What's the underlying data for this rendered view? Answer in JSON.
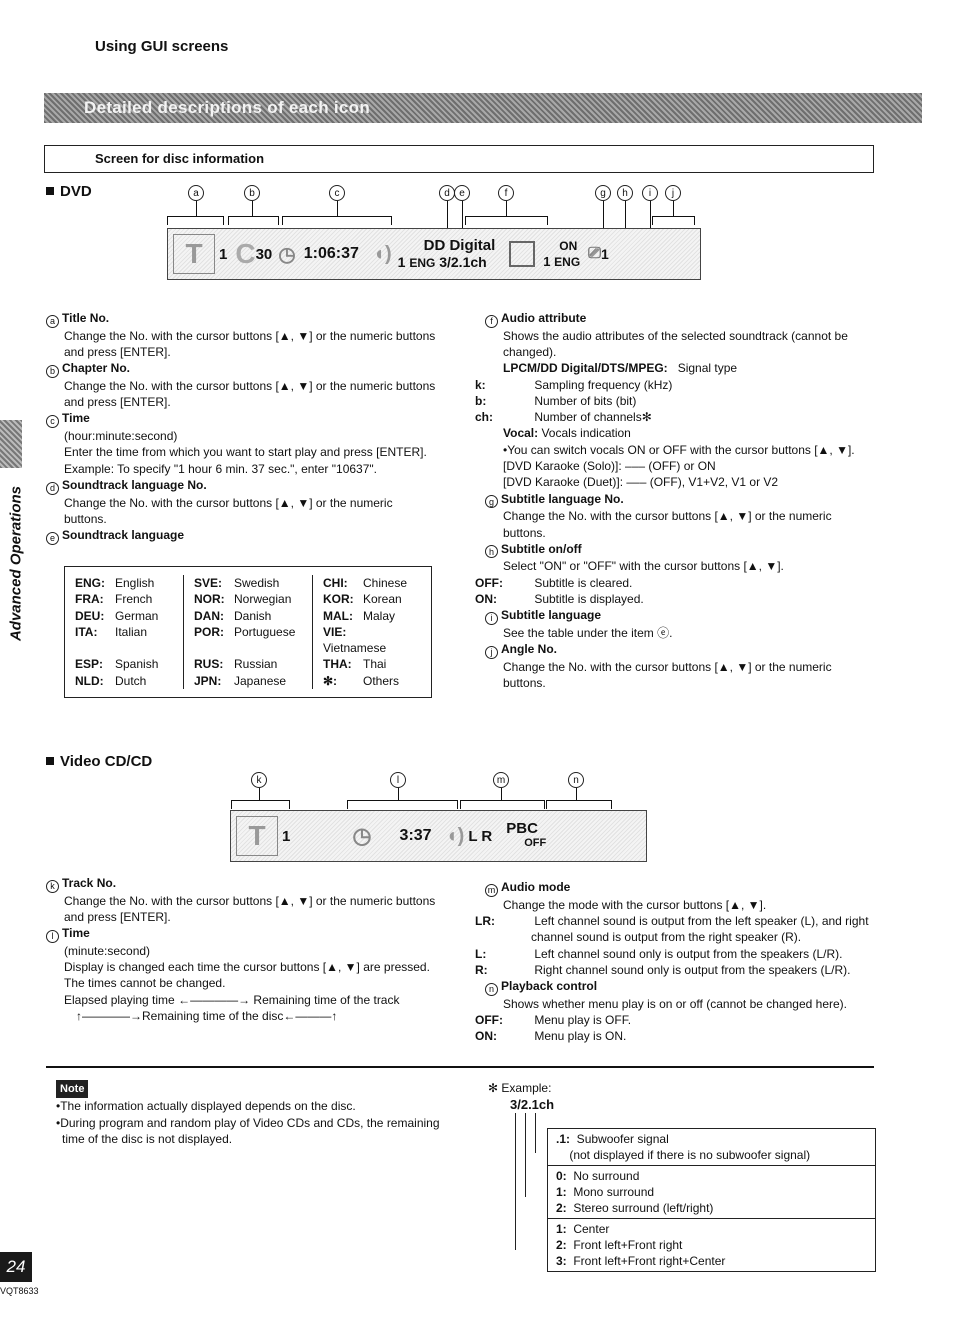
{
  "header": {
    "section_title": "Using GUI screens",
    "banner": "Detailed descriptions of each icon",
    "screen_box_label": "Screen for disc information"
  },
  "side": {
    "tab_label": "Advanced Operations"
  },
  "dvd": {
    "heading": "DVD",
    "callouts": [
      "a",
      "b",
      "c",
      "d",
      "e",
      "f",
      "g",
      "h",
      "i",
      "j"
    ],
    "bar": {
      "title_no": "1",
      "chapter_no": "30",
      "time": "1:06:37",
      "audio_lang_no": "1",
      "audio_lang": "ENG",
      "audio_attr_line1": "DD Digital",
      "audio_attr_line2": "3/2.1ch",
      "subtitle_state": "ON",
      "subtitle_no": "1",
      "subtitle_lang": "ENG",
      "angle_no": "1"
    },
    "left_items": [
      {
        "mark": "a",
        "title": "Title No.",
        "body": [
          "Change the No. with the cursor buttons [▲, ▼] or the numeric buttons and press [ENTER]."
        ]
      },
      {
        "mark": "b",
        "title": "Chapter No.",
        "body": [
          "Change the No. with the cursor buttons [▲, ▼] or the numeric buttons and press [ENTER]."
        ]
      },
      {
        "mark": "c",
        "title": "Time",
        "body": [
          "(hour:minute:second)",
          "Enter the time from which you want to start play and press [ENTER].",
          "Example: To specify \"1 hour 6 min. 37 sec.\", enter \"10637\"."
        ]
      },
      {
        "mark": "d",
        "title": "Soundtrack language No.",
        "body": [
          "Change the No. with the cursor buttons [▲, ▼] or the numeric buttons."
        ]
      },
      {
        "mark": "e",
        "title": "Soundtrack language",
        "body": []
      }
    ],
    "languages": [
      [
        {
          "k": "ENG:",
          "v": "English"
        },
        {
          "k": "FRA:",
          "v": "French"
        },
        {
          "k": "DEU:",
          "v": "German"
        },
        {
          "k": "ITA:",
          "v": "Italian"
        },
        {
          "k": "ESP:",
          "v": "Spanish"
        },
        {
          "k": "NLD:",
          "v": "Dutch"
        }
      ],
      [
        {
          "k": "SVE:",
          "v": "Swedish"
        },
        {
          "k": "NOR:",
          "v": "Norwegian"
        },
        {
          "k": "DAN:",
          "v": "Danish"
        },
        {
          "k": "POR:",
          "v": "Portuguese"
        },
        {
          "k": "RUS:",
          "v": "Russian"
        },
        {
          "k": "JPN:",
          "v": "Japanese"
        }
      ],
      [
        {
          "k": "CHI:",
          "v": "Chinese"
        },
        {
          "k": "KOR:",
          "v": "Korean"
        },
        {
          "k": "MAL:",
          "v": "Malay"
        },
        {
          "k": "VIE:",
          "v": "Vietnamese"
        },
        {
          "k": "THA:",
          "v": "Thai"
        },
        {
          "k": "✻:",
          "v": "Others"
        }
      ]
    ],
    "right_items": {
      "f": {
        "title": "Audio attribute",
        "intro": "Shows the audio attributes of the selected soundtrack (cannot be changed).",
        "signal_label": "LPCM/DD Digital/DTS/MPEG:",
        "signal_value": "Signal type",
        "defs": [
          {
            "k": "k:",
            "v": "Sampling frequency (kHz)"
          },
          {
            "k": "b:",
            "v": "Number of bits (bit)"
          },
          {
            "k": "ch:",
            "v": "Number of channels✻"
          }
        ],
        "vocal_label": "Vocal:",
        "vocal_value": "Vocals indication",
        "vocal_bullet": "•You can switch vocals ON or OFF with the cursor buttons [▲, ▼].",
        "karaoke_solo": "[DVD Karaoke (Solo)]: ––– (OFF) or ON",
        "karaoke_duet": "[DVD Karaoke (Duet)]: ––– (OFF), V1+V2, V1 or V2"
      },
      "g": {
        "title": "Subtitle language No.",
        "body": "Change the No. with the cursor buttons [▲, ▼] or the numeric buttons."
      },
      "h": {
        "title": "Subtitle on/off",
        "body": "Select \"ON\" or \"OFF\" with the cursor buttons [▲, ▼].",
        "defs": [
          {
            "k": "OFF:",
            "v": "Subtitle is cleared."
          },
          {
            "k": "ON:",
            "v": "Subtitle is displayed."
          }
        ]
      },
      "i": {
        "title": "Subtitle language",
        "body": "See the table under the item ⓔ."
      },
      "j": {
        "title": "Angle No.",
        "body": "Change the No. with the cursor buttons [▲, ▼] or the numeric buttons."
      }
    }
  },
  "vcd": {
    "heading": "Video CD/CD",
    "callouts": [
      "k",
      "l",
      "m",
      "n"
    ],
    "bar": {
      "track_no": "1",
      "time": "3:37",
      "audio_mode": "L R",
      "pbc_label": "PBC",
      "pbc_state": "OFF"
    },
    "k": {
      "title": "Track No.",
      "body": "Change the No. with the cursor buttons [▲, ▼] or the numeric buttons and press [ENTER]."
    },
    "l": {
      "title": "Time",
      "sub": "(minute:second)",
      "body": "Display is changed each time the cursor buttons [▲, ▼] are pressed. The times cannot be changed.",
      "flow_line1_a": "Elapsed playing time",
      "flow_line1_b": "Remaining time of the track",
      "flow_line2": "Remaining time of the disc"
    },
    "m": {
      "title": "Audio mode",
      "body": "Change the mode with the cursor buttons [▲, ▼].",
      "defs": [
        {
          "k": "LR:",
          "v": "Left channel sound is output from the left speaker (L), and right channel sound is output from the right speaker (R)."
        },
        {
          "k": "L:",
          "v": "Left channel sound only is output from the speakers (L/R)."
        },
        {
          "k": "R:",
          "v": "Right channel sound only is output from the speakers (L/R)."
        }
      ]
    },
    "n": {
      "title": "Playback control",
      "body": "Shows whether menu play is on or off (cannot be changed here).",
      "defs": [
        {
          "k": "OFF:",
          "v": "Menu play is OFF."
        },
        {
          "k": "ON:",
          "v": "Menu play is ON."
        }
      ]
    }
  },
  "note": {
    "label": "Note",
    "bullets": [
      "•The information actually displayed depends on the disc.",
      "•During program and random play of Video CDs and CDs, the remaining time of the disc is not displayed."
    ]
  },
  "example": {
    "label": "✻ Example:",
    "value": "3/2.1ch",
    "rows": [
      [
        "<b>.1:</b>  Subwoofer signal",
        "    (not displayed if there is no subwoofer signal)"
      ],
      [
        "<b>0:</b>  No surround",
        "<b>1:</b>  Mono surround",
        "<b>2:</b>  Stereo surround (left/right)"
      ],
      [
        "<b>1:</b>  Center",
        "<b>2:</b>  Front left+Front right",
        "<b>3:</b>  Front left+Front right+Center"
      ]
    ]
  },
  "footer": {
    "page_number": "24",
    "doc_code": "VQT8633"
  }
}
